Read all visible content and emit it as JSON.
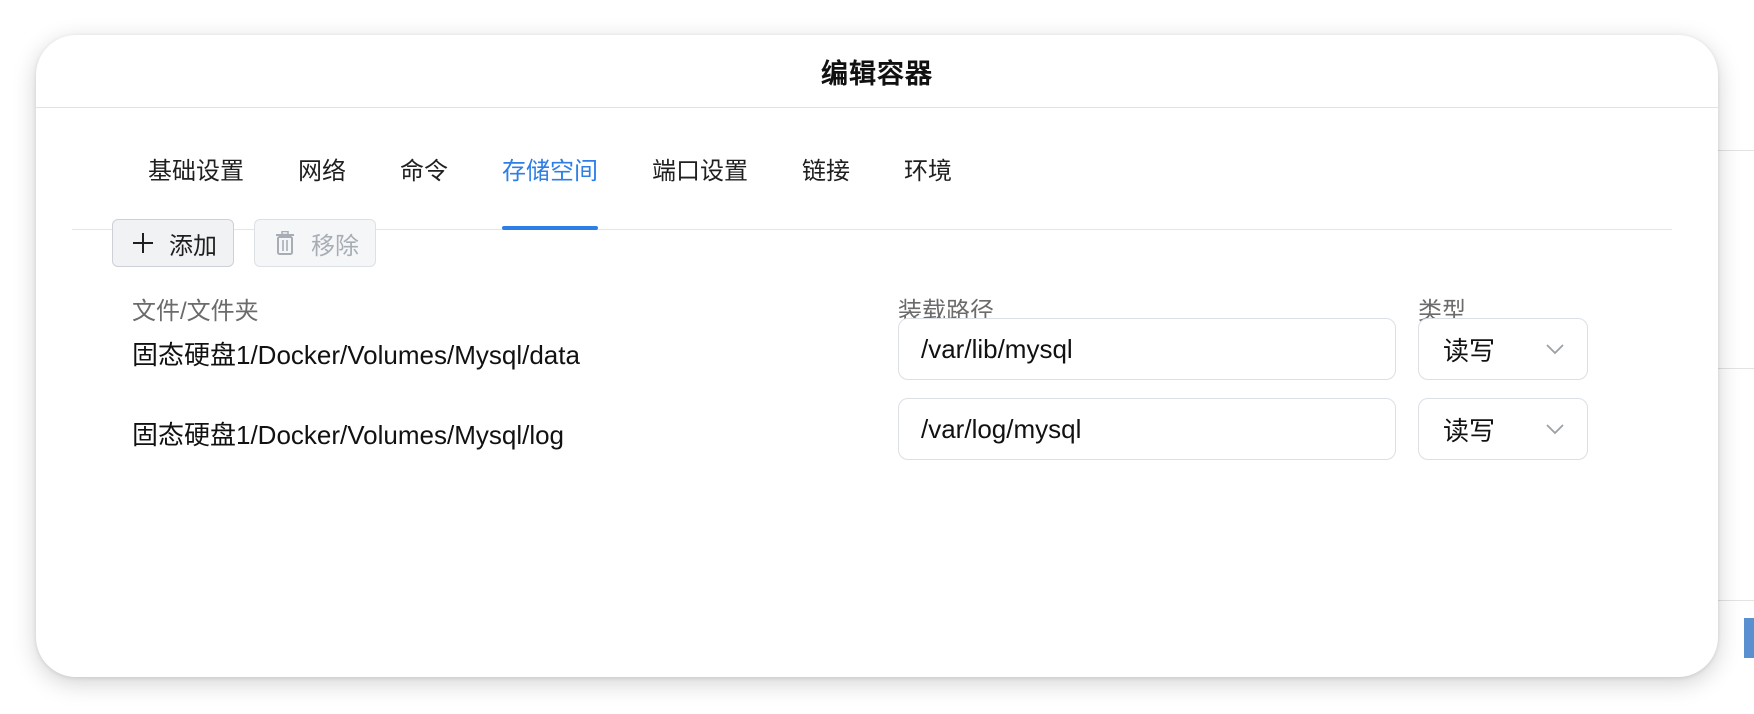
{
  "dialog": {
    "title": "编辑容器"
  },
  "tabs": [
    {
      "label": "基础设置"
    },
    {
      "label": "网络"
    },
    {
      "label": "命令"
    },
    {
      "label": "存储空间",
      "active": true
    },
    {
      "label": "端口设置"
    },
    {
      "label": "链接"
    },
    {
      "label": "环境"
    }
  ],
  "toolbar": {
    "add_label": "添加",
    "add_icon": "plus-icon",
    "remove_label": "移除",
    "remove_icon": "trash-icon"
  },
  "table": {
    "headers": {
      "file": "文件/文件夹",
      "mount": "装载路径",
      "type": "类型"
    },
    "rows": [
      {
        "file": "固态硬盘1/Docker/Volumes/Mysql/data",
        "mount": "/var/lib/mysql",
        "type": "读写"
      },
      {
        "file": "固态硬盘1/Docker/Volumes/Mysql/log",
        "mount": "/var/log/mysql",
        "type": "读写"
      }
    ]
  },
  "colors": {
    "accent": "#2f7ee6",
    "text": "#111111",
    "muted": "#6b6b6b"
  }
}
